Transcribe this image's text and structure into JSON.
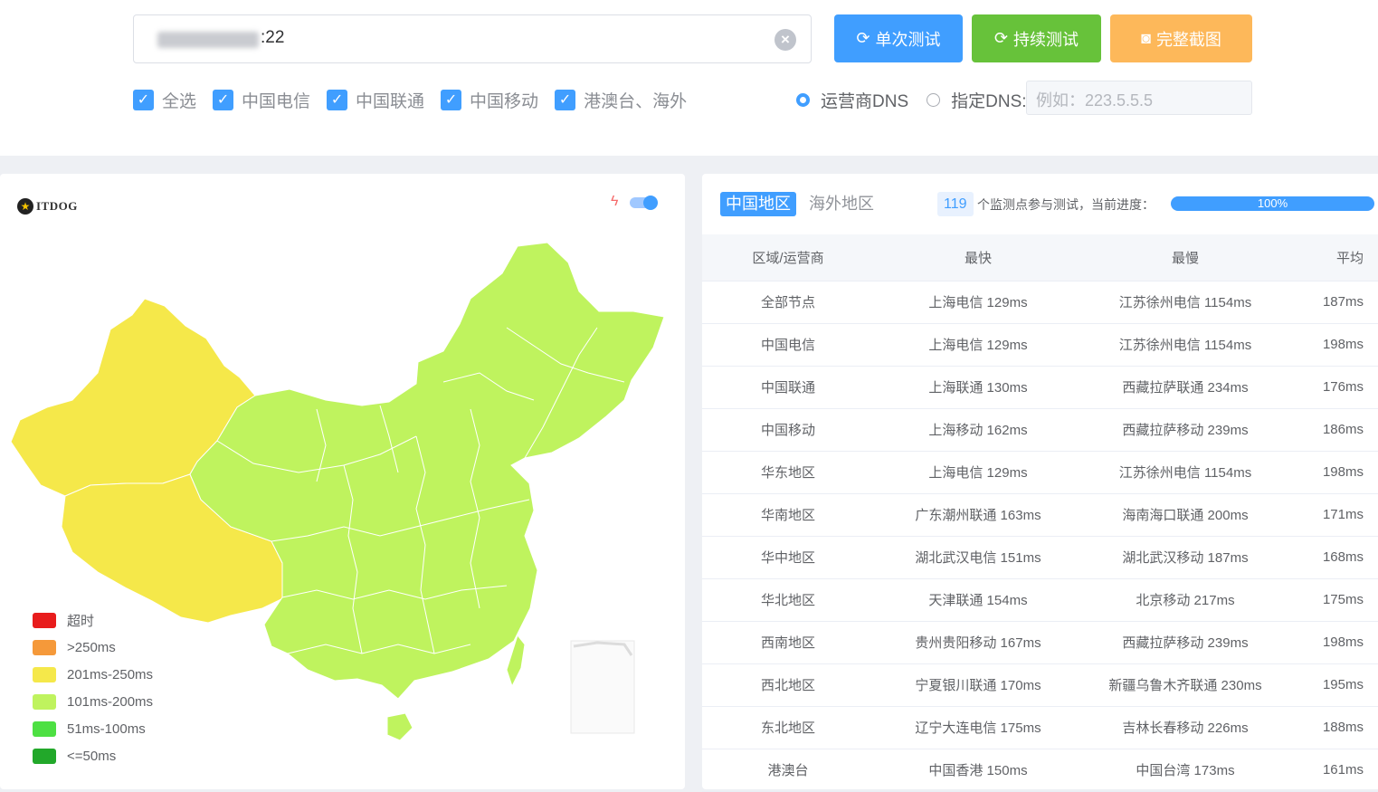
{
  "form": {
    "host_suffix": ":22",
    "buttons": {
      "single_test": "单次测试",
      "continuous_test": "持续测试",
      "full_screenshot": "完整截图"
    },
    "checkboxes": [
      "全选",
      "中国电信",
      "中国联通",
      "中国移动",
      "港澳台、海外"
    ],
    "dns_options": {
      "isp_dns": "运营商DNS",
      "custom_dns": "指定DNS:",
      "custom_placeholder": "例如：223.5.5.5"
    }
  },
  "map": {
    "logo_text": "ITDOG",
    "legend": [
      {
        "label": "超时",
        "color": "#e81c1c"
      },
      {
        "label": ">250ms",
        "color": "#f5993a"
      },
      {
        "label": "201ms-250ms",
        "color": "#f5e84a"
      },
      {
        "label": "101ms-200ms",
        "color": "#bff35e"
      },
      {
        "label": "51ms-100ms",
        "color": "#4de042"
      },
      {
        "label": "<=50ms",
        "color": "#22a82a"
      }
    ]
  },
  "results": {
    "tabs": {
      "china": "中国地区",
      "overseas": "海外地区"
    },
    "node_count": "119",
    "node_text": "个监测点参与测试，当前进度：",
    "progress": 100,
    "progress_label": "100%",
    "columns": [
      "区域/运营商",
      "最快",
      "最慢",
      "平均"
    ],
    "rows": [
      [
        "全部节点",
        "上海电信 129ms",
        "江苏徐州电信 1154ms",
        "187ms"
      ],
      [
        "中国电信",
        "上海电信 129ms",
        "江苏徐州电信 1154ms",
        "198ms"
      ],
      [
        "中国联通",
        "上海联通 130ms",
        "西藏拉萨联通 234ms",
        "176ms"
      ],
      [
        "中国移动",
        "上海移动 162ms",
        "西藏拉萨移动 239ms",
        "186ms"
      ],
      [
        "华东地区",
        "上海电信 129ms",
        "江苏徐州电信 1154ms",
        "198ms"
      ],
      [
        "华南地区",
        "广东潮州联通 163ms",
        "海南海口联通 200ms",
        "171ms"
      ],
      [
        "华中地区",
        "湖北武汉电信 151ms",
        "湖北武汉移动 187ms",
        "168ms"
      ],
      [
        "华北地区",
        "天津联通 154ms",
        "北京移动 217ms",
        "175ms"
      ],
      [
        "西南地区",
        "贵州贵阳移动 167ms",
        "西藏拉萨移动 239ms",
        "198ms"
      ],
      [
        "西北地区",
        "宁夏银川联通 170ms",
        "新疆乌鲁木齐联通 230ms",
        "195ms"
      ],
      [
        "东北地区",
        "辽宁大连电信 175ms",
        "吉林长春移动 226ms",
        "188ms"
      ],
      [
        "港澳台",
        "中国香港 150ms",
        "中国台湾 173ms",
        "161ms"
      ]
    ]
  },
  "colors": {
    "primary": "#409eff",
    "success": "#67c23a",
    "warning": "#fdb85a",
    "map_yellow": "#f5e84a",
    "map_green": "#bff35e"
  }
}
